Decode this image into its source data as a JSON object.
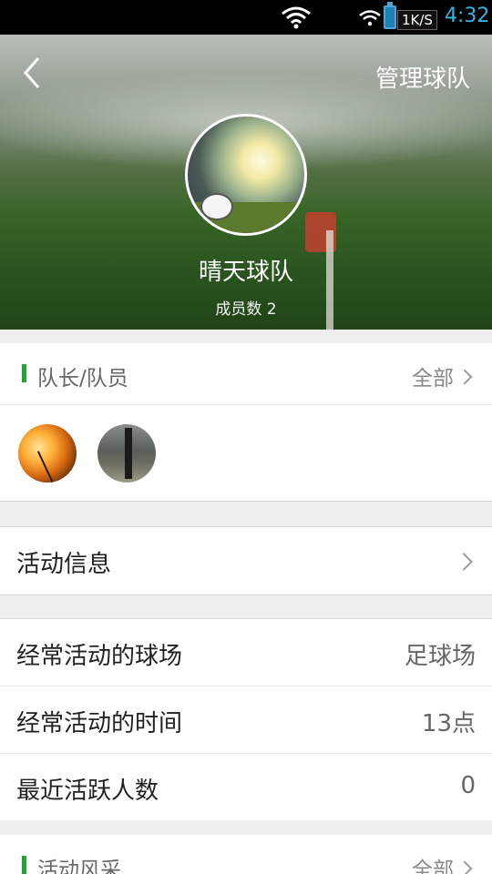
{
  "status_bar": {
    "network_speed": "1K/S",
    "time": "4:32",
    "icons": [
      "wifi-icon",
      "wifi-icon",
      "battery-icon"
    ]
  },
  "header": {
    "back_icon": "chevron-left-icon",
    "manage_label": "管理球队",
    "team_name": "晴天球队",
    "member_count": "成员数 2"
  },
  "members_section": {
    "title": "队长/队员",
    "more_label": "全部",
    "members": [
      {
        "avatar": "sunset-photo"
      },
      {
        "avatar": "street-photo"
      }
    ]
  },
  "activity_section": {
    "label": "活动信息"
  },
  "info_rows": [
    {
      "label": "经常活动的球场",
      "value": "足球场"
    },
    {
      "label": "经常活动的时间",
      "value": "13点"
    },
    {
      "label": "最近活跃人数",
      "value": "0"
    }
  ],
  "gallery_section": {
    "title": "活动风采",
    "more_label": "全部"
  },
  "colors": {
    "accent_green": "#22a33a",
    "clock_blue": "#33b5e5"
  }
}
